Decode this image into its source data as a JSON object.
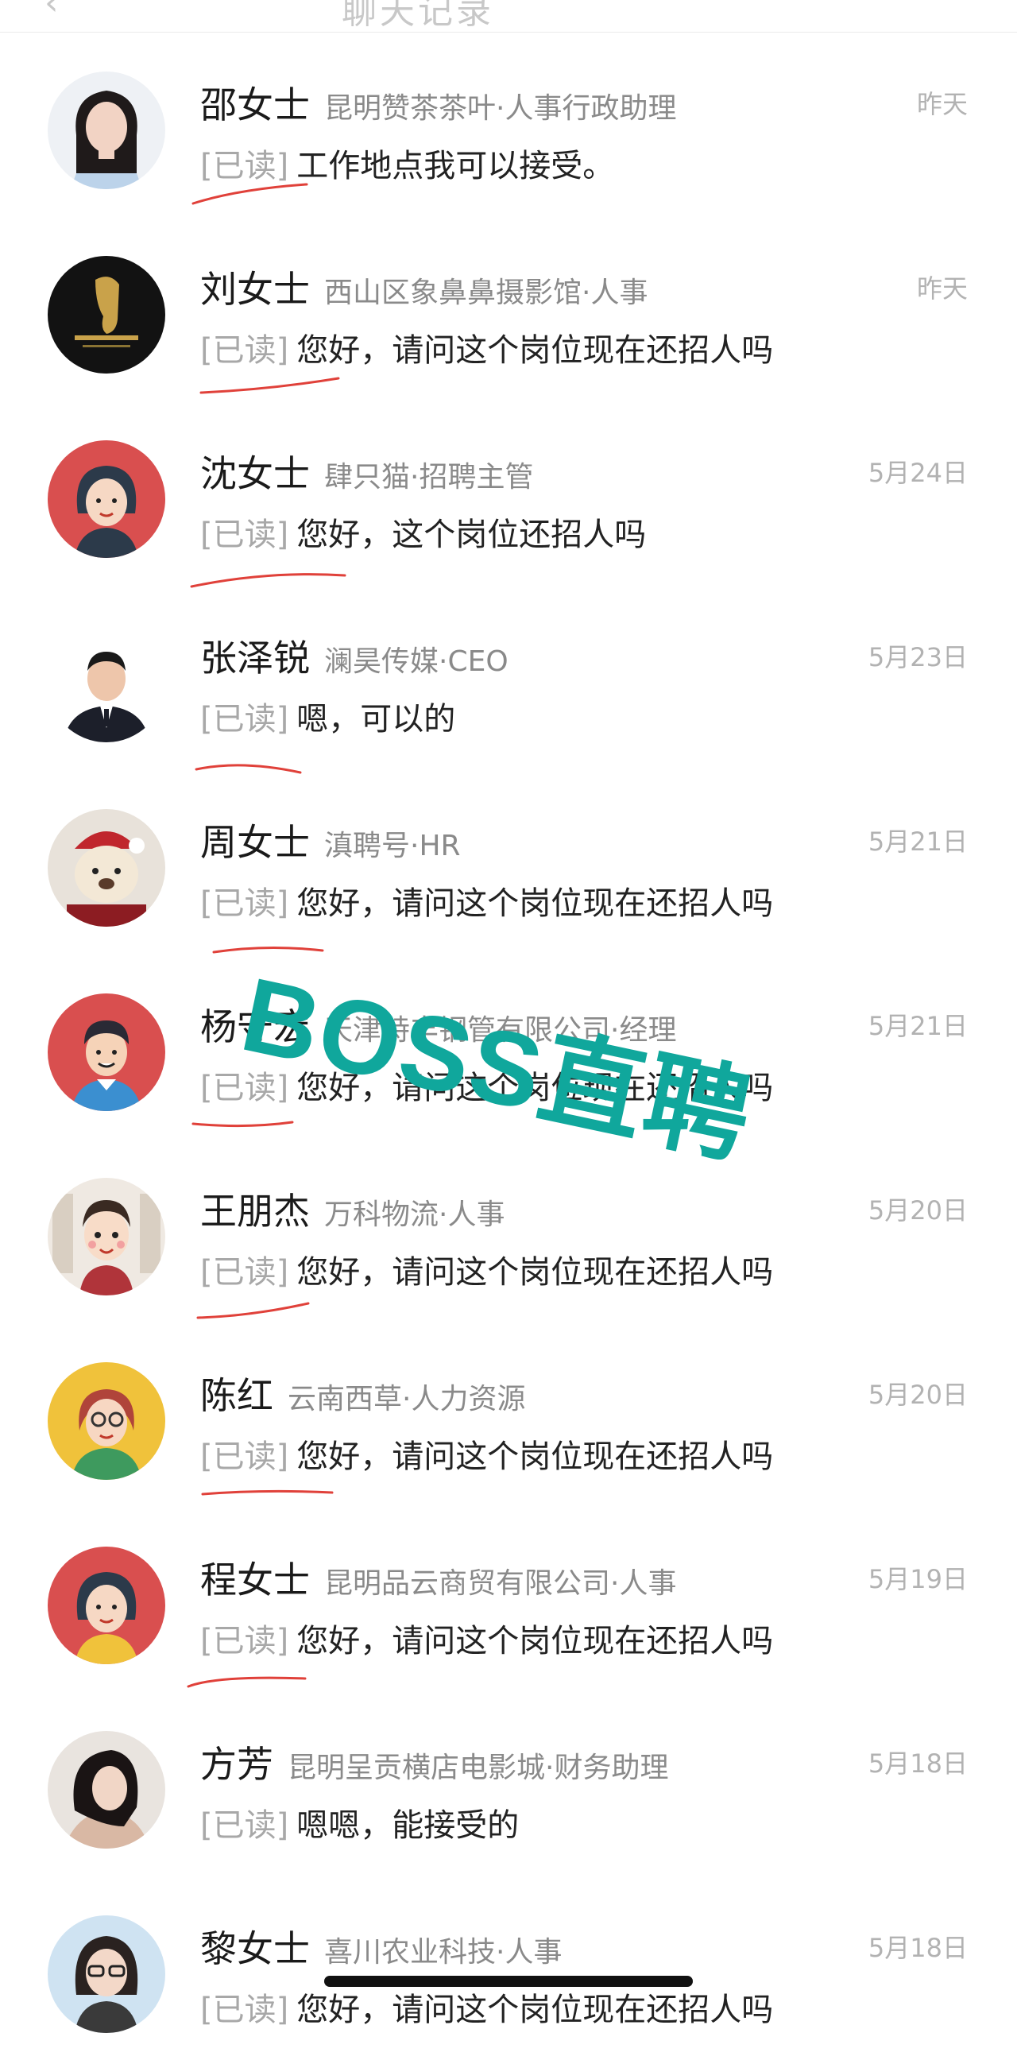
{
  "header": {
    "back_glyph": "‹",
    "title": "聊天记录"
  },
  "read_tag": "[已读]",
  "conversations": [
    {
      "name": "邵女士",
      "company": "昆明赞茶茶叶·人事行政助理",
      "time": "昨天",
      "message": "工作地点我可以接受。",
      "avatar": "woman-photo-avatar"
    },
    {
      "name": "刘女士",
      "company": "西山区象鼻鼻摄影馆·人事",
      "time": "昨天",
      "message": "您好，请问这个岗位现在还招人吗",
      "avatar": "elephant-logo-avatar"
    },
    {
      "name": "沈女士",
      "company": "肆只猫·招聘主管",
      "time": "5月24日",
      "message": "您好，这个岗位还招人吗",
      "avatar": "cartoon-woman-avatar"
    },
    {
      "name": "张泽锐",
      "company": "澜昊传媒·CEO",
      "time": "5月23日",
      "message": "嗯，可以的",
      "avatar": "suit-man-avatar"
    },
    {
      "name": "周女士",
      "company": "滇聘号·HR",
      "time": "5月21日",
      "message": "您好，请问这个岗位现在还招人吗",
      "avatar": "teddy-bear-avatar"
    },
    {
      "name": "杨守宏",
      "company": "天津特丰钢管有限公司·经理",
      "time": "5月21日",
      "message": "您好，请问这个岗位现在还招人吗",
      "avatar": "cartoon-man-avatar"
    },
    {
      "name": "王朋杰",
      "company": "万科物流·人事",
      "time": "5月20日",
      "message": "您好，请问这个岗位现在还招人吗",
      "avatar": "cartoon-boy-avatar"
    },
    {
      "name": "陈红",
      "company": "云南西草·人力资源",
      "time": "5月20日",
      "message": "您好，请问这个岗位现在还招人吗",
      "avatar": "cartoon-glasses-woman-avatar"
    },
    {
      "name": "程女士",
      "company": "昆明品云商贸有限公司·人事",
      "time": "5月19日",
      "message": "您好，请问这个岗位现在还招人吗",
      "avatar": "cartoon-woman-avatar"
    },
    {
      "name": "方芳",
      "company": "昆明呈贡横店电影城·财务助理",
      "time": "5月18日",
      "message": "嗯嗯，能接受的",
      "avatar": "woman-photo-avatar"
    },
    {
      "name": "黎女士",
      "company": "喜川农业科技·人事",
      "time": "5月18日",
      "message": "您好，请问这个岗位现在还招人吗",
      "avatar": "glasses-woman-photo-avatar"
    }
  ],
  "watermark": "BOSS直聘",
  "colors": {
    "annotation_red": "#e0413a",
    "watermark_teal": "#10a79c",
    "avatar_red": "#d94f4f",
    "avatar_yellow": "#f0c23b"
  }
}
